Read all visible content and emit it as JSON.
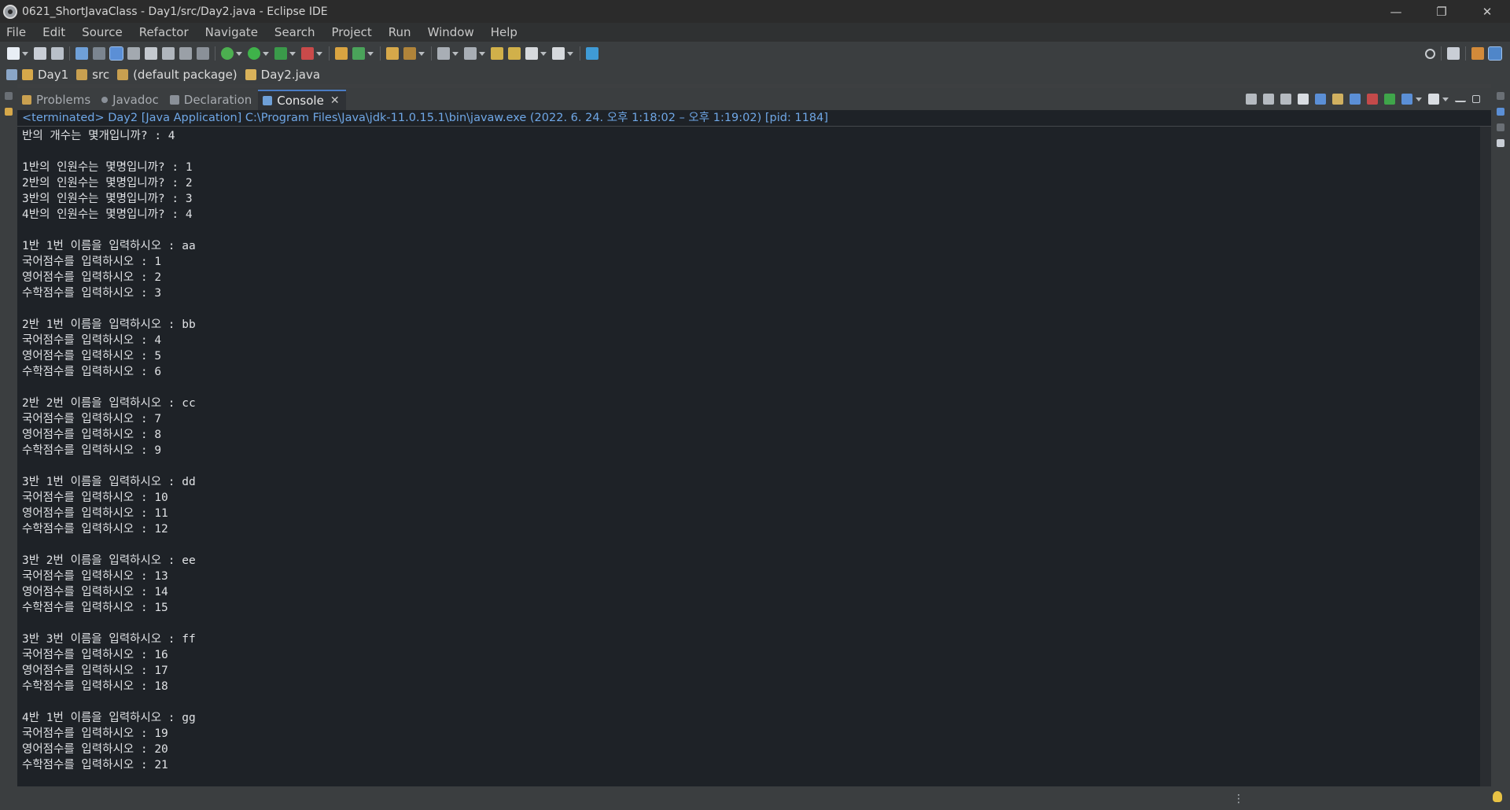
{
  "window": {
    "title": "0621_ShortJavaClass - Day1/src/Day2.java - Eclipse IDE",
    "minimize": "—",
    "restore": "❐",
    "close": "✕"
  },
  "menu": {
    "items": [
      "File",
      "Edit",
      "Source",
      "Refactor",
      "Navigate",
      "Search",
      "Project",
      "Run",
      "Window",
      "Help"
    ]
  },
  "breadcrumb": {
    "items": [
      "Day1",
      "src",
      "(default package)",
      "Day2.java"
    ]
  },
  "view_tabs": {
    "items": [
      "Problems",
      "Javadoc",
      "Declaration",
      "Console"
    ],
    "active": "Console",
    "close_glyph": "✕"
  },
  "console": {
    "header": "<terminated> Day2 [Java Application] C:\\Program Files\\Java\\jdk-11.0.15.1\\bin\\javaw.exe  (2022. 6. 24. 오후 1:18:02 – 오후 1:19:02) [pid: 1184]",
    "lines": [
      "반의 개수는 몇개입니까? : 4",
      "",
      "1반의 인원수는 몇명입니까? : 1",
      "2반의 인원수는 몇명입니까? : 2",
      "3반의 인원수는 몇명입니까? : 3",
      "4반의 인원수는 몇명입니까? : 4",
      "",
      "1반 1번 이름을 입력하시오 : aa",
      "국어점수를 입력하시오 : 1",
      "영어점수를 입력하시오 : 2",
      "수학점수를 입력하시오 : 3",
      "",
      "2반 1번 이름을 입력하시오 : bb",
      "국어점수를 입력하시오 : 4",
      "영어점수를 입력하시오 : 5",
      "수학점수를 입력하시오 : 6",
      "",
      "2반 2번 이름을 입력하시오 : cc",
      "국어점수를 입력하시오 : 7",
      "영어점수를 입력하시오 : 8",
      "수학점수를 입력하시오 : 9",
      "",
      "3반 1번 이름을 입력하시오 : dd",
      "국어점수를 입력하시오 : 10",
      "영어점수를 입력하시오 : 11",
      "수학점수를 입력하시오 : 12",
      "",
      "3반 2번 이름을 입력하시오 : ee",
      "국어점수를 입력하시오 : 13",
      "영어점수를 입력하시오 : 14",
      "수학점수를 입력하시오 : 15",
      "",
      "3반 3번 이름을 입력하시오 : ff",
      "국어점수를 입력하시오 : 16",
      "영어점수를 입력하시오 : 17",
      "수학점수를 입력하시오 : 18",
      "",
      "4반 1번 이름을 입력하시오 : gg",
      "국어점수를 입력하시오 : 19",
      "영어점수를 입력하시오 : 20",
      "수학점수를 입력하시오 : 21"
    ]
  },
  "colors": {
    "console_bg": "#1e2227",
    "header_text": "#6fa7e6",
    "active_tab_accent": "#4a7cc4"
  }
}
